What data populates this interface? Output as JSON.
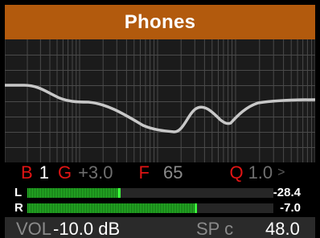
{
  "title": "Phones",
  "params": {
    "band_key": "B",
    "band_value": "1",
    "gain_key": "G",
    "gain_value": "+3.0",
    "freq_key": "F",
    "freq_value": "65",
    "q_key": "Q",
    "q_value": "1.0",
    "next_icon": "chevron-right-icon"
  },
  "meters": {
    "left": {
      "label": "L",
      "value": "-28.4",
      "fill": 0.37,
      "peak": 0.37
    },
    "right": {
      "label": "R",
      "value": "-7.0",
      "fill": 0.68,
      "peak": 0.68
    }
  },
  "bottom": {
    "vol_label": "VOL",
    "vol_value": "-10.0 dB",
    "sp_label": "SP c",
    "sp_value": "48.0"
  },
  "colors": {
    "title_bg": "#b25a0d",
    "param_key": "#e01414",
    "meter_green": "#2ecc2e",
    "curve": "#c8c8c8"
  }
}
